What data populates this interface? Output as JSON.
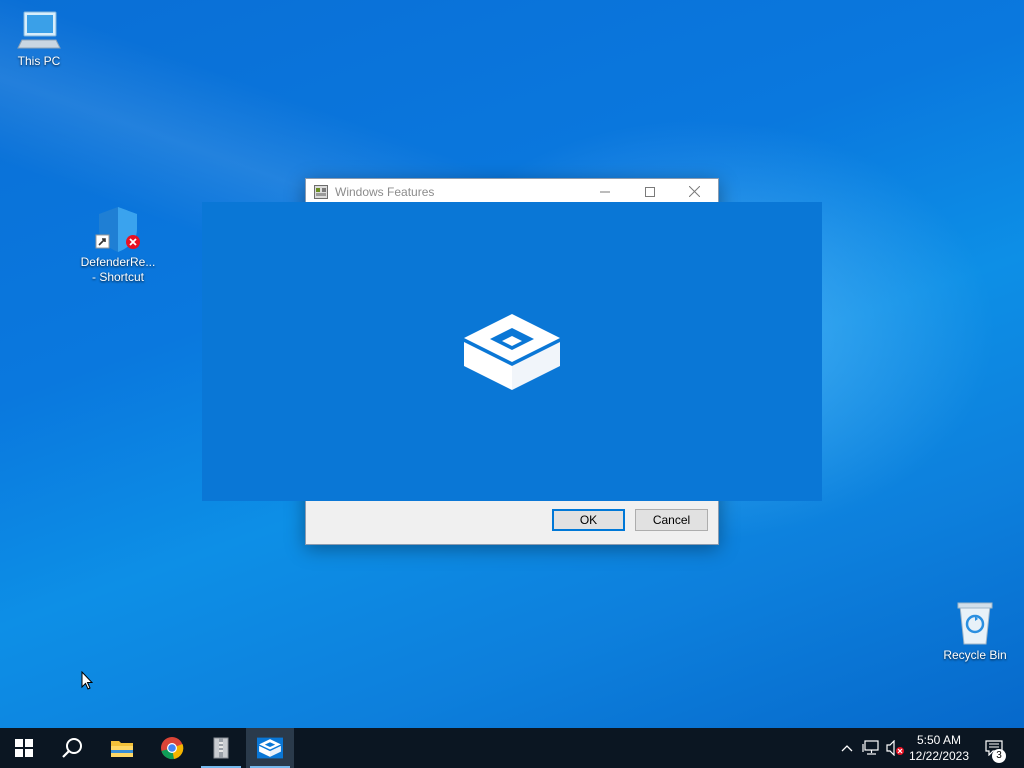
{
  "desktop": {
    "icons": {
      "this_pc": "This PC",
      "defender_line1": "DefenderRe...",
      "defender_line2": "- Shortcut",
      "recycle_bin": "Recycle Bin"
    }
  },
  "dialog": {
    "title": "Windows Features",
    "ok_label": "OK",
    "cancel_label": "Cancel"
  },
  "taskbar": {
    "start_icon": "windows-logo-icon",
    "search_icon": "search-icon",
    "pinned": [
      {
        "name": "file-explorer",
        "icon": "folder-icon"
      },
      {
        "name": "chrome",
        "icon": "chrome-icon"
      },
      {
        "name": "packaged-app",
        "icon": "archive-icon",
        "running": true
      },
      {
        "name": "windows-features",
        "icon": "package-box-icon",
        "active": true
      }
    ],
    "clock": {
      "time": "5:50 AM",
      "date": "12/22/2023"
    },
    "notifications_count": "3"
  },
  "colors": {
    "accent": "#0078d7",
    "splash_bg": "#0a77d6",
    "taskbar_bg": "#0b1622"
  }
}
